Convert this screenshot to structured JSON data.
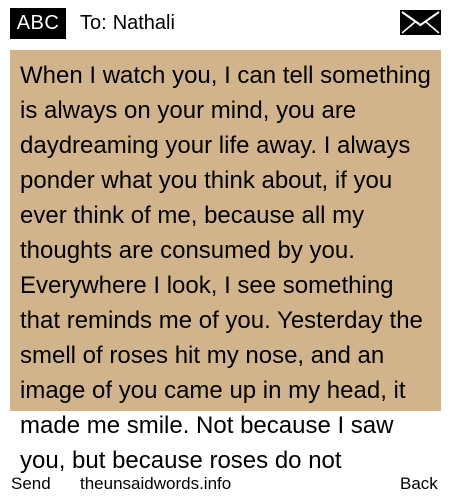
{
  "header": {
    "mode": "ABC",
    "recipient_prefix": "To:",
    "recipient_name": "Nathali",
    "envelope_icon": "envelope-icon"
  },
  "message": {
    "text": "When I watch you, I can tell something is always on your mind, you are daydreaming your life away. I always ponder what you think about, if you ever think of me, because all my thoughts are consumed by you. Everywhere I look, I see something that reminds me of you. Yesterday the smell of roses hit my nose, and an image of you came up in my head, it made me smile. Not because I saw you, but because roses do not"
  },
  "softkeys": {
    "left": "Send",
    "center": "theunsaidwords.info",
    "right": "Back"
  },
  "colors": {
    "panel": "#d2b48c",
    "badge": "#000000",
    "text": "#000000",
    "background": "#ffffff"
  }
}
